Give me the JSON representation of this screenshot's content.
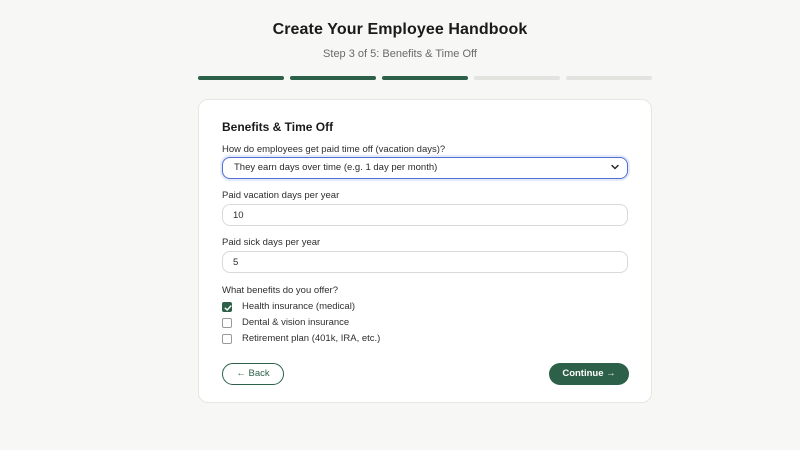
{
  "header": {
    "title": "Create Your Employee Handbook",
    "subtitle": "Step 3 of 5: Benefits & Time Off"
  },
  "progress": {
    "current_step": 3,
    "total_steps": 5
  },
  "card": {
    "title": "Benefits & Time Off",
    "pto_question": "How do employees get paid time off (vacation days)?",
    "pto_select_value": "They earn days over time (e.g. 1 day per month)",
    "vacation_label": "Paid vacation days per year",
    "vacation_value": "10",
    "sick_label": "Paid sick days per year",
    "sick_value": "5",
    "benefits_label": "What benefits do you offer?",
    "benefits": [
      {
        "label": "Health insurance (medical)",
        "checked": true
      },
      {
        "label": "Dental & vision insurance",
        "checked": false
      },
      {
        "label": "Retirement plan (401k, IRA, etc.)",
        "checked": false
      }
    ],
    "back_label": "← Back",
    "continue_label": "Continue →"
  },
  "colors": {
    "accent": "#2d6048",
    "focus": "#4f6fd6",
    "progress_empty": "#e3e3e0"
  }
}
